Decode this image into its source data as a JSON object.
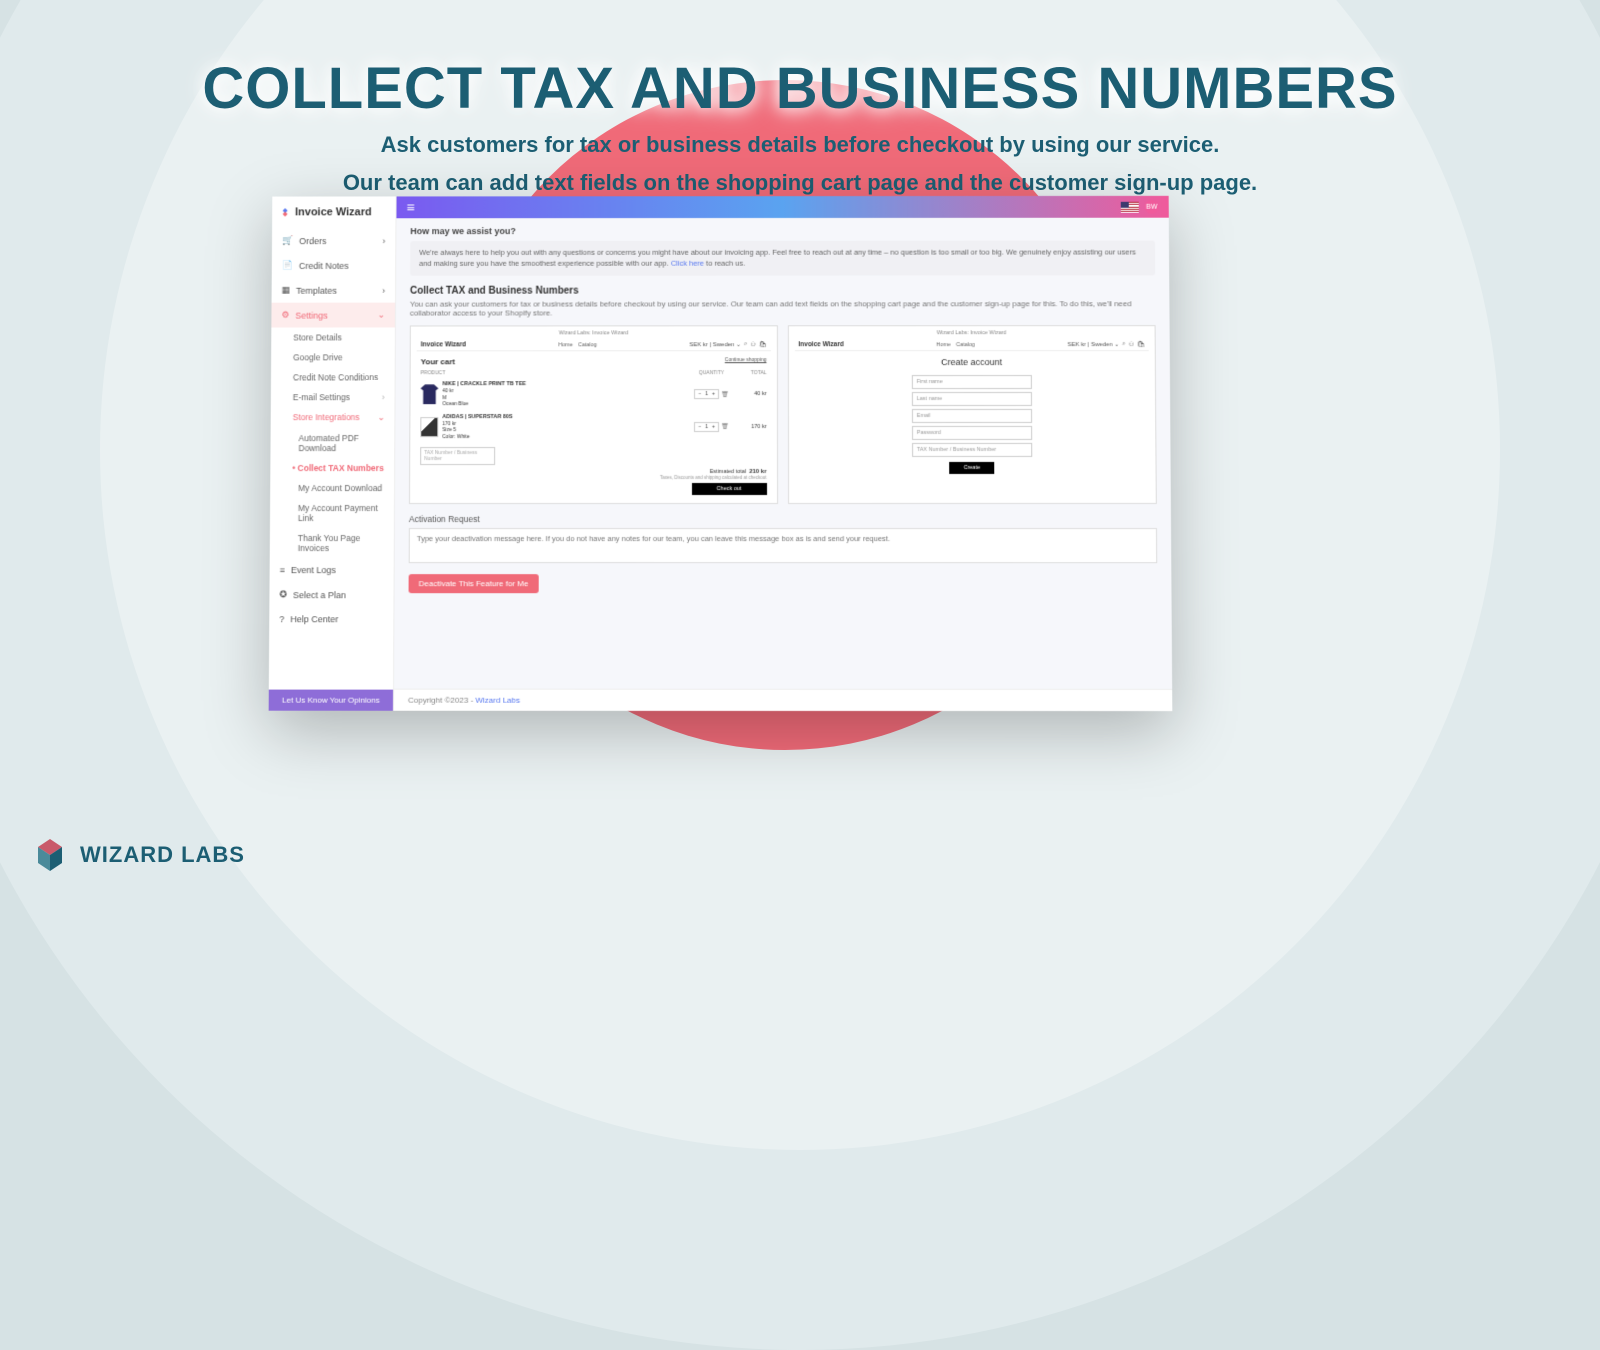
{
  "hero": {
    "title": "COLLECT TAX AND BUSINESS NUMBERS",
    "sub1": "Ask customers for tax or business details before checkout by using our service.",
    "sub2": "Our team can add text fields on the shopping cart page and the customer sign-up page."
  },
  "brand_logo": "WIZARD LABS",
  "sidebar": {
    "logo": "Invoice Wizard",
    "items": {
      "orders": "Orders",
      "credit_notes": "Credit Notes",
      "templates": "Templates",
      "settings": "Settings",
      "event_logs": "Event Logs",
      "select_plan": "Select a Plan",
      "help": "Help Center"
    },
    "subs": {
      "store_details": "Store Details",
      "google_drive": "Google Drive",
      "credit_cond": "Credit Note Conditions",
      "email": "E-mail Settings",
      "integrations": "Store Integrations",
      "auto_pdf": "Automated PDF Download",
      "collect_tax": "Collect TAX Numbers",
      "my_dl": "My Account Download",
      "my_pay": "My Account Payment Link",
      "thankyou": "Thank You Page Invoices"
    },
    "footer": "Let Us Know Your Opinions"
  },
  "topbar": {
    "avatar": "BW"
  },
  "assist": {
    "title": "How may we assist you?",
    "body1": "We're always here to help you out with any questions or concerns you might have about our invoicing app. Feel free to reach out at any time – no question is too small or too big. We genuinely enjoy assisting our users and making sure you have the smoothest experience possible with our app. ",
    "link": "Click here",
    "body2": " to reach us."
  },
  "section": {
    "title": "Collect TAX and Business Numbers",
    "desc": "You can ask your customers for tax or business details before checkout by using our service. Our team can add text fields on the shopping cart page and the customer sign-up page for this. To do this, we'll need collaborator access to your Shopify store."
  },
  "preview": {
    "top": "Wizard Labs: Invoice Wizard",
    "brand": "Invoice Wizard",
    "nav_home": "Home",
    "nav_catalog": "Catalog",
    "locale": "SEK kr | Sweden ⌄",
    "cart_title": "Your cart",
    "continue": "Continue shopping",
    "col_product": "PRODUCT",
    "col_qty": "QUANTITY",
    "col_total": "TOTAL",
    "p1_title": "NIKE | CRACKLE PRINT TB TEE",
    "p1_price": "40 kr",
    "p1_l2": "M",
    "p1_l3": "Ocean Blue",
    "p2_title": "ADIDAS | SUPERSTAR 80S",
    "p2_price": "170 kr",
    "p2_l2": "Size 5",
    "p2_l3": "Color: White",
    "qty_val": "1",
    "tax_ph": "TAX Number / Business Number",
    "est_label": "Estimated total",
    "est_val": "210 kr",
    "note": "Taxes, Discounts and shipping calculated at checkout",
    "checkout": "Check out",
    "create_title": "Create account",
    "f_first": "First name",
    "f_last": "Last name",
    "f_email": "Email",
    "f_pass": "Password",
    "f_tax": "TAX Number / Business Number",
    "create_btn": "Create"
  },
  "activation": {
    "title": "Activation Request",
    "placeholder": "Type your deactivation message here. If you do not have any notes for our team, you can leave this message box as is and send your request.",
    "button": "Deactivate This Feature for Me"
  },
  "footer": {
    "copy": "Copyright ©2023 - ",
    "link": "Wizard Labs"
  }
}
